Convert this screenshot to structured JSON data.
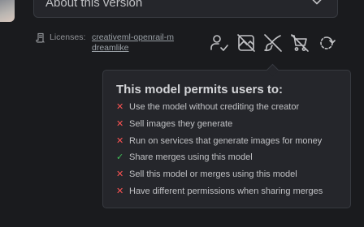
{
  "accordion": {
    "label": "About this version"
  },
  "licenses": {
    "label": "Licenses:",
    "links": [
      "creativeml-openrail-m",
      "dreamlike"
    ]
  },
  "permission_icons": [
    "user-check-icon",
    "no-image-icon",
    "no-brush-icon",
    "no-cart-icon",
    "refresh-dashed-icon"
  ],
  "popover": {
    "title": "This model permits users to:",
    "items": [
      {
        "status": "denied",
        "mark": "✕",
        "text": "Use the model without crediting the creator"
      },
      {
        "status": "denied",
        "mark": "✕",
        "text": "Sell images they generate"
      },
      {
        "status": "denied",
        "mark": "✕",
        "text": "Run on services that generate images for money"
      },
      {
        "status": "allowed",
        "mark": "✓",
        "text": "Share merges using this model"
      },
      {
        "status": "denied",
        "mark": "✕",
        "text": "Sell this model or merges using this model"
      },
      {
        "status": "denied",
        "mark": "✕",
        "text": "Have different permissions when sharing merges"
      }
    ]
  },
  "colors": {
    "background": "#1a1b1e",
    "panel": "#25262b",
    "border": "#373a40",
    "denied": "#fa5252",
    "allowed": "#40c057"
  }
}
